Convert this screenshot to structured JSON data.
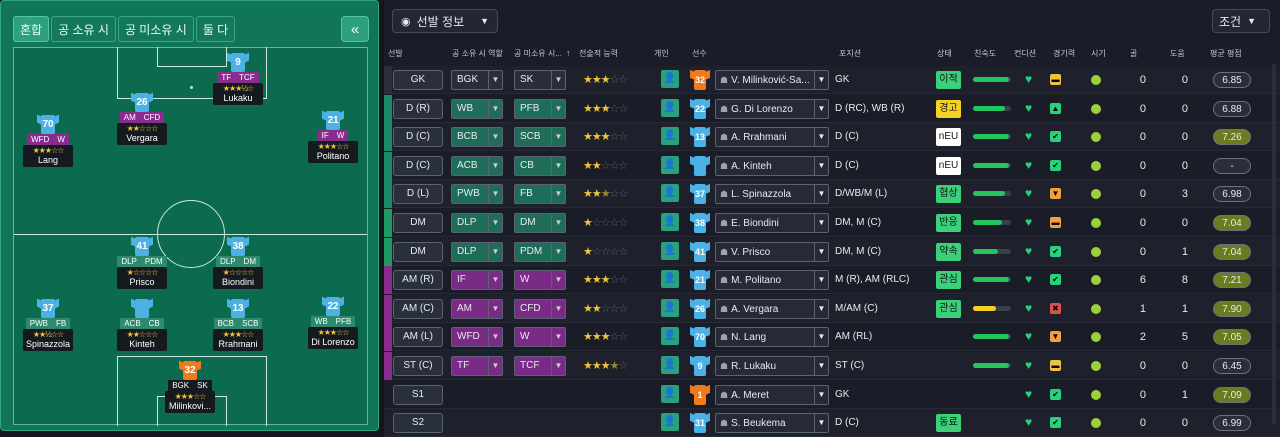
{
  "left_panel": {
    "tabs": [
      "혼합",
      "공 소유 시",
      "공 미소유 시",
      "둘 다"
    ],
    "active_tab": 0,
    "collapse_icon": "«",
    "players": [
      {
        "id": "lukaku",
        "number": "9",
        "name": "Lukaku",
        "roles": [
          "TF",
          "TCF"
        ],
        "role_color": "purple",
        "stars": "★★★½☆"
      },
      {
        "id": "vergara",
        "number": "26",
        "name": "Vergara",
        "roles": [
          "AM",
          "CFD"
        ],
        "role_color": "purple",
        "stars": "★★☆☆☆"
      },
      {
        "id": "lang",
        "number": "70",
        "name": "Lang",
        "roles": [
          "WFD",
          "W"
        ],
        "role_color": "purple",
        "stars": "★★★☆☆"
      },
      {
        "id": "politano",
        "number": "21",
        "name": "Politano",
        "roles": [
          "IF",
          "W"
        ],
        "role_color": "purple",
        "stars": "★★★☆☆"
      },
      {
        "id": "prisco",
        "number": "41",
        "name": "Prisco",
        "roles": [
          "DLP",
          "PDM"
        ],
        "role_color": "green",
        "stars": "★☆☆☆☆"
      },
      {
        "id": "biondini",
        "number": "38",
        "name": "Biondini",
        "roles": [
          "DLP",
          "DM"
        ],
        "role_color": "green",
        "stars": "★☆☆☆☆"
      },
      {
        "id": "spinazzola",
        "number": "37",
        "name": "Spinazzola",
        "roles": [
          "PWB",
          "FB"
        ],
        "role_color": "green",
        "stars": "★★½☆☆"
      },
      {
        "id": "kinteh",
        "number": "",
        "name": "Kinteh",
        "roles": [
          "ACB",
          "CB"
        ],
        "role_color": "green",
        "stars": "★★☆☆☆"
      },
      {
        "id": "rrahmani",
        "number": "13",
        "name": "Rrahmani",
        "roles": [
          "BCB",
          "SCB"
        ],
        "role_color": "green",
        "stars": "★★★☆☆"
      },
      {
        "id": "dilorenzo",
        "number": "22",
        "name": "Di Lorenzo",
        "roles": [
          "WB",
          "PFB"
        ],
        "role_color": "green",
        "stars": "★★★☆☆"
      },
      {
        "id": "milinkovic",
        "number": "32",
        "name": "Milinkovi...",
        "roles": [
          "BGK",
          "SK"
        ],
        "role_color": "dark",
        "stars": "★★★☆☆",
        "gk": true
      }
    ]
  },
  "right_panel": {
    "view_button": "선발 정보",
    "condition_button": "조건",
    "headers": [
      "선발",
      "공 소유 시 역할",
      "공 미소유 시...",
      "전술적 능력",
      "개인",
      "선수",
      "포지션",
      "상태",
      "친숙도",
      "컨디션",
      "경기력",
      "시기",
      "골",
      "도움",
      "평균 평점"
    ],
    "rows": [
      {
        "pos": "GK",
        "ip": "BGK",
        "oop": "SK",
        "strip": "#2a2f3c",
        "role_bg": "#2a2e3a",
        "stars": [
          3,
          0,
          2
        ],
        "number": "32",
        "gk": true,
        "player": "V. Milinković-Sa...",
        "position": "GK",
        "status": "이적",
        "status_color": "#3ad17a",
        "fam": 0.95,
        "box": "#f0c040",
        "box_t": "▬",
        "goals": "0",
        "assists": "0",
        "rating": "6.85",
        "rating_color": "#2a2e3a"
      },
      {
        "pos": "D (R)",
        "ip": "WB",
        "oop": "PFB",
        "strip": "#1d8a6a",
        "role_bg": "#1f6d58",
        "stars": [
          3,
          0,
          2
        ],
        "number": "22",
        "player": "G. Di Lorenzo",
        "position": "D (RC), WB (R)",
        "status": "경고",
        "status_color": "#f2d224",
        "fam": 0.85,
        "box": "#27d27a",
        "box_t": "▲",
        "goals": "0",
        "assists": "0",
        "rating": "6.88",
        "rating_color": "#2a2e3a"
      },
      {
        "pos": "D (C)",
        "ip": "BCB",
        "oop": "SCB",
        "strip": "#1d8a6a",
        "role_bg": "#1f6d58",
        "stars": [
          3,
          0,
          2
        ],
        "number": "13",
        "player": "A. Rrahmani",
        "position": "D (C)",
        "status": "nEU",
        "status_color": "#ffffff",
        "fam": 0.95,
        "box": "#27d27a",
        "box_t": "✔",
        "goals": "0",
        "assists": "0",
        "rating": "7.26",
        "rating_color": "#6b7b1f"
      },
      {
        "pos": "D (C)",
        "ip": "ACB",
        "oop": "CB",
        "strip": "#1d8a6a",
        "role_bg": "#1f6d58",
        "stars": [
          2,
          0,
          3
        ],
        "number": "",
        "player": "A. Kinteh",
        "position": "D (C)",
        "status": "nEU",
        "status_color": "#ffffff",
        "fam": 0.95,
        "box": "#27d27a",
        "box_t": "✔",
        "goals": "0",
        "assists": "0",
        "rating": "-",
        "rating_color": "#2a2e3a"
      },
      {
        "pos": "D (L)",
        "ip": "PWB",
        "oop": "FB",
        "strip": "#1d8a6a",
        "role_bg": "#1f6d58",
        "stars": [
          2,
          1,
          2
        ],
        "number": "37",
        "player": "L. Spinazzola",
        "position": "D/WB/M (L)",
        "status": "협상",
        "status_color": "#3ad17a",
        "fam": 0.85,
        "box": "#f0a040",
        "box_t": "▼",
        "goals": "0",
        "assists": "3",
        "rating": "6.98",
        "rating_color": "#2a2e3a"
      },
      {
        "pos": "DM",
        "ip": "DLP",
        "oop": "DM",
        "strip": "#1f9a64",
        "role_bg": "#1f6d58",
        "stars": [
          1,
          0,
          4
        ],
        "number": "38",
        "player": "E. Biondini",
        "position": "DM, M (C)",
        "status": "반응",
        "status_color": "#3ad17a",
        "fam": 0.75,
        "box": "#f0a040",
        "box_t": "▬",
        "goals": "0",
        "assists": "0",
        "rating": "7.04",
        "rating_color": "#6b7b1f"
      },
      {
        "pos": "DM",
        "ip": "DLP",
        "oop": "PDM",
        "strip": "#1f9a64",
        "role_bg": "#1f6d58",
        "stars": [
          1,
          0,
          4
        ],
        "number": "41",
        "player": "V. Prisco",
        "position": "DM, M (C)",
        "status": "약속",
        "status_color": "#3ad17a",
        "fam": 0.65,
        "box": "#27d27a",
        "box_t": "✔",
        "goals": "0",
        "assists": "1",
        "rating": "7.04",
        "rating_color": "#6b7b1f"
      },
      {
        "pos": "AM (R)",
        "ip": "IF",
        "oop": "W",
        "strip": "#8a2b8e",
        "role_bg": "#7a2b85",
        "stars": [
          3,
          0,
          2
        ],
        "number": "21",
        "player": "M. Politano",
        "position": "M (R), AM (RLC)",
        "status": "관심",
        "status_color": "#3ad17a",
        "fam": 0.95,
        "box": "#27d27a",
        "box_t": "✔",
        "goals": "6",
        "assists": "8",
        "rating": "7.21",
        "rating_color": "#6b7b1f"
      },
      {
        "pos": "AM (C)",
        "ip": "AM",
        "oop": "CFD",
        "strip": "#8a2b8e",
        "role_bg": "#7a2b85",
        "stars": [
          2,
          0,
          3
        ],
        "number": "26",
        "player": "A. Vergara",
        "position": "M/AM (C)",
        "status": "관심",
        "status_color": "#3ad17a",
        "fam": 0.6,
        "fam_color": "#f2d224",
        "box": "#e05050",
        "box_t": "✖",
        "goals": "1",
        "assists": "1",
        "rating": "7.90",
        "rating_color": "#6b7b1f"
      },
      {
        "pos": "AM (L)",
        "ip": "WFD",
        "oop": "W",
        "strip": "#8a2b8e",
        "role_bg": "#7a2b85",
        "stars": [
          3,
          0,
          2
        ],
        "number": "70",
        "player": "N. Lang",
        "position": "AM (RL)",
        "status": "",
        "status_color": "",
        "fam": 0.95,
        "box": "#f0a040",
        "box_t": "▼",
        "goals": "2",
        "assists": "5",
        "rating": "7.05",
        "rating_color": "#6b7b1f"
      },
      {
        "pos": "ST (C)",
        "ip": "TF",
        "oop": "TCF",
        "strip": "#8a2b8e",
        "role_bg": "#7a2b85",
        "stars": [
          3,
          1,
          1
        ],
        "number": "9",
        "player": "R. Lukaku",
        "position": "ST (C)",
        "status": "",
        "status_color": "",
        "fam": 0.95,
        "box": "#f0c040",
        "box_t": "▬",
        "goals": "0",
        "assists": "0",
        "rating": "6.45",
        "rating_color": "#2a2e3a"
      },
      {
        "pos": "S1",
        "ip": "",
        "oop": "",
        "strip": "",
        "role_bg": "",
        "stars": null,
        "number": "1",
        "gk": true,
        "player": "A. Meret",
        "position": "GK",
        "status": "",
        "status_color": "",
        "fam": null,
        "box": "#27d27a",
        "box_t": "✔",
        "goals": "0",
        "assists": "1",
        "rating": "7.09",
        "rating_color": "#6b7b1f"
      },
      {
        "pos": "S2",
        "ip": "",
        "oop": "",
        "strip": "",
        "role_bg": "",
        "stars": null,
        "number": "31",
        "player": "S. Beukema",
        "position": "D (C)",
        "status": "동료",
        "status_color": "#3ad17a",
        "fam": null,
        "box": "#27d27a",
        "box_t": "✔",
        "goals": "0",
        "assists": "0",
        "rating": "6.99",
        "rating_color": "#2a2e3a"
      }
    ]
  }
}
